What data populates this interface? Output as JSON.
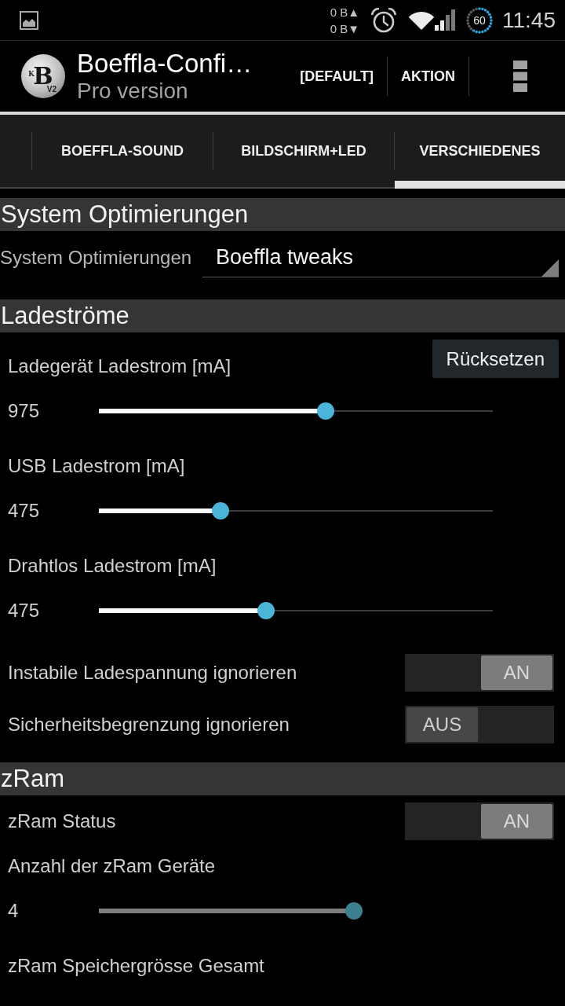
{
  "status_bar": {
    "traffic": [
      "0 B▲",
      "0 B▼"
    ],
    "battery": "60",
    "time": "11:45"
  },
  "action_bar": {
    "logo": {
      "mark": "K",
      "letter": "B",
      "version": "V2"
    },
    "title": "Boeffla-Confi…",
    "subtitle": "Pro version",
    "actions": [
      "[DEFAULT]",
      "AKTION"
    ]
  },
  "tabs": [
    {
      "label": "BOEFFLA-SOUND",
      "selected": false
    },
    {
      "label": "BILDSCHIRM+LED",
      "selected": false
    },
    {
      "label": "VERSCHIEDENES",
      "selected": true
    }
  ],
  "sections": [
    {
      "title": "System Optimierungen",
      "items": [
        {
          "kind": "dropdown",
          "label": "System Optimierungen",
          "value": "Boeffla tweaks"
        }
      ]
    },
    {
      "title": "Ladeströme",
      "action": "Rücksetzen",
      "items": [
        {
          "kind": "slider",
          "label": "Ladegerät Ladestrom [mA]",
          "reading": "975",
          "level": 0.58,
          "disabled": false
        },
        {
          "kind": "slider",
          "label": "USB Ladestrom [mA]",
          "reading": "475",
          "level": 0.3,
          "disabled": false
        },
        {
          "kind": "slider",
          "label": "Drahtlos Ladestrom [mA]",
          "reading": "475",
          "level": 0.42,
          "disabled": false
        },
        {
          "kind": "toggle",
          "label": "Instabile Ladespannung ignorieren",
          "on": true,
          "state_text": "AN"
        },
        {
          "kind": "toggle",
          "label": "Sicherheitsbegrenzung ignorieren",
          "on": false,
          "state_text": "AUS"
        }
      ]
    },
    {
      "title": "zRam",
      "items": [
        {
          "kind": "toggle",
          "label": "zRam Status",
          "on": true,
          "state_text": "AN"
        },
        {
          "kind": "slider",
          "label": "Anzahl der zRam Geräte",
          "reading": "4",
          "level": 1,
          "disabled": true
        },
        {
          "kind": "label",
          "label": "zRam Speichergrösse Gesamt"
        }
      ]
    }
  ]
}
